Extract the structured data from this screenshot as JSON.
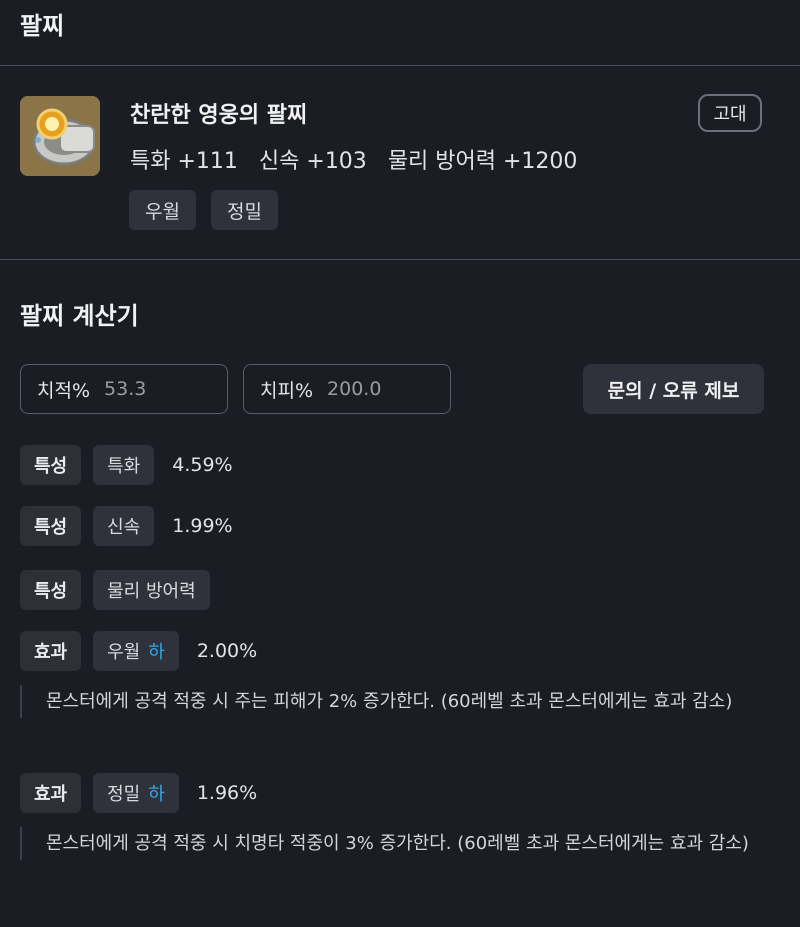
{
  "header": {
    "title": "팔찌"
  },
  "item": {
    "icon": "bracelet-icon",
    "name": "찬란한 영웅의 팔찌",
    "grade": "고대",
    "stats": [
      "특화 +111",
      "신속 +103",
      "물리 방어력 +1200"
    ],
    "tags": [
      "우월",
      "정밀"
    ]
  },
  "calculator": {
    "title": "팔찌 계산기",
    "crit_rate": {
      "label": "치적%",
      "value": "53.3"
    },
    "crit_dmg": {
      "label": "치피%",
      "value": "200.0"
    },
    "report_button": "문의 / 오류 제보",
    "rows": [
      {
        "type": "특성",
        "name": "특화",
        "level": "",
        "percent": "4.59%"
      },
      {
        "type": "특성",
        "name": "신속",
        "level": "",
        "percent": "1.99%"
      },
      {
        "type": "특성",
        "name": "물리 방어력",
        "level": "",
        "percent": ""
      },
      {
        "type": "효과",
        "name": "우월",
        "level": "하",
        "percent": "2.00%",
        "description": "몬스터에게 공격 적중 시 주는 피해가 2% 증가한다. (60레벨 초과 몬스터에게는 효과 감소)"
      },
      {
        "type": "효과",
        "name": "정밀",
        "level": "하",
        "percent": "1.96%",
        "description": "몬스터에게 공격 적중 시 치명타 적중이 3% 증가한다. (60레벨 초과 몬스터에게는 효과 감소)"
      }
    ]
  },
  "colors": {
    "background": "#1b1d24",
    "chip": "#30323b",
    "level_accent": "#33a6e8"
  }
}
